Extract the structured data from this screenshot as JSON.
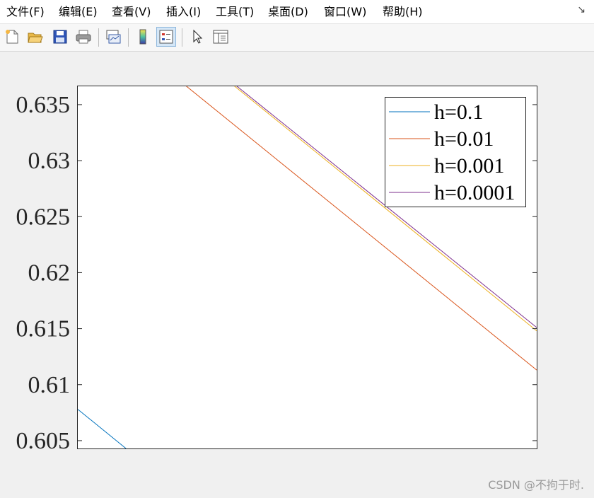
{
  "menubar": {
    "items": [
      {
        "label": "文件(F)"
      },
      {
        "label": "编辑(E)"
      },
      {
        "label": "查看(V)"
      },
      {
        "label": "插入(I)"
      },
      {
        "label": "工具(T)"
      },
      {
        "label": "桌面(D)"
      },
      {
        "label": "窗口(W)"
      },
      {
        "label": "帮助(H)"
      }
    ],
    "corner_icon": "dock-arrow-icon"
  },
  "toolbar": {
    "buttons": [
      {
        "icon": "new-figure-icon"
      },
      {
        "icon": "open-file-icon"
      },
      {
        "icon": "save-icon"
      },
      {
        "icon": "print-icon"
      },
      {
        "icon": "link-plot-icon"
      },
      {
        "icon": "insert-colorbar-icon"
      },
      {
        "icon": "insert-legend-icon",
        "active": true
      },
      {
        "icon": "edit-pointer-icon"
      },
      {
        "icon": "property-inspector-icon"
      }
    ]
  },
  "chart_data": {
    "type": "line",
    "title": "",
    "xlabel": "",
    "ylabel": "",
    "ylim": [
      0.6043,
      0.6367
    ],
    "yticks": [
      "0.605",
      "0.61",
      "0.615",
      "0.62",
      "0.625",
      "0.63",
      "0.635"
    ],
    "xticks_visible": false,
    "xlim": [
      0,
      1
    ],
    "grid": false,
    "legend_position": "top-right",
    "series": [
      {
        "name": "h=0.1",
        "color": "#0072bd",
        "x": [
          0,
          0.105
        ],
        "y": [
          0.6078,
          0.6043
        ]
      },
      {
        "name": "h=0.01",
        "color": "#d95319",
        "x": [
          0.235,
          1
        ],
        "y": [
          0.6367,
          0.6113
        ]
      },
      {
        "name": "h=0.001",
        "color": "#edb120",
        "x": [
          0.34,
          1
        ],
        "y": [
          0.6367,
          0.6148
        ]
      },
      {
        "name": "h=0.0001",
        "color": "#7e2f8e",
        "x": [
          0.345,
          1
        ],
        "y": [
          0.6367,
          0.6151
        ]
      }
    ]
  },
  "watermark": "CSDN @不拘于时."
}
